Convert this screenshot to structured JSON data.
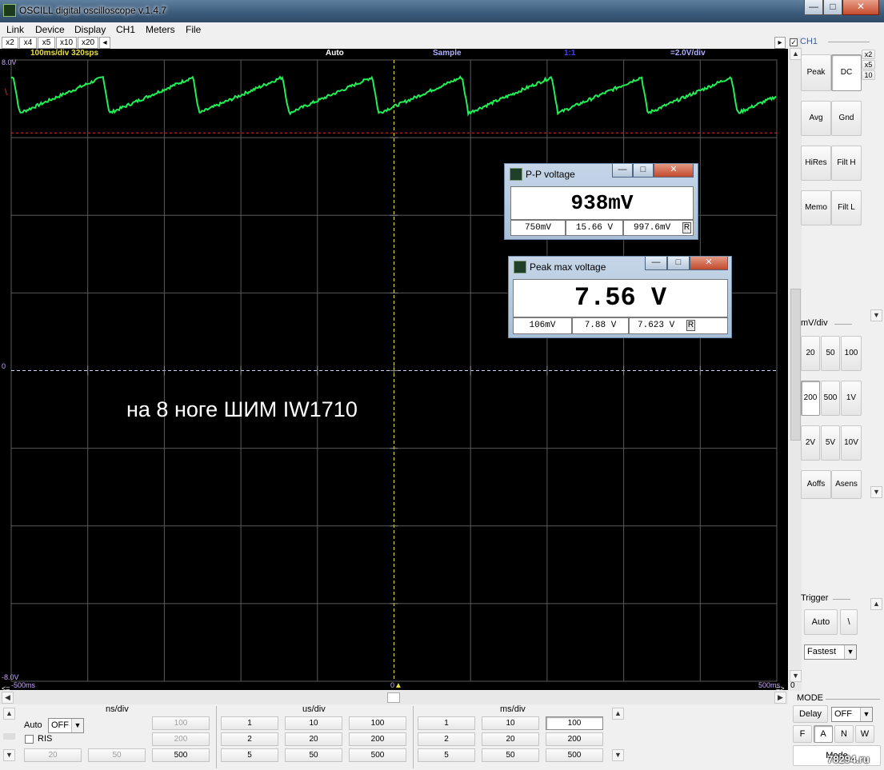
{
  "window": {
    "title": "OSCILL digital oscilloscope  v.1.4.7",
    "min_label": "—",
    "max_label": "□",
    "close_label": "✕"
  },
  "menu": [
    "Link",
    "Device",
    "Display",
    "CH1",
    "Meters",
    "File"
  ],
  "zoom_buttons": [
    "x2",
    "x4",
    "x5",
    "x10",
    "x20"
  ],
  "zoom_arrow": "◂",
  "scope_header": {
    "timebase": "100ms/div  320sps",
    "trigger": "Auto",
    "acq": "Sample",
    "ratio": "1:1",
    "vscale": "=2.0V/div"
  },
  "scope_labels": {
    "top_v": "8.0V",
    "zero_v": "0",
    "bottom_v": "-8.0V",
    "left_t": "-500ms",
    "center_t": "0",
    "right_t": "500ms",
    "left_arrow": "<=",
    "right_arrow": "=>",
    "ch_marker": "\\"
  },
  "annotation": "на 8 ноге ШИМ IW1710",
  "colors": {
    "trace": "#22ee55",
    "trigger_level": "#e03030",
    "cursor": "#e8e040",
    "grid": "#5a5a5a",
    "header_time": "#e8e040",
    "header_trig": "#ffffff",
    "header_acq": "#b0b0ff",
    "header_ratio": "#4040ff",
    "header_v": "#b0b0ff"
  },
  "meters": [
    {
      "title": "P-P voltage",
      "value": "938mV",
      "min": "750mV",
      "max": "15.66 V",
      "avg": "997.6mV",
      "reset": "R"
    },
    {
      "title": "Peak max voltage",
      "value": "7.56 V",
      "min": "106mV",
      "max": "7.88 V",
      "avg": "7.623 V",
      "reset": "R"
    }
  ],
  "right_panel": {
    "channel": "CH1",
    "zoom": [
      "x2",
      "x5",
      "10"
    ],
    "buttons": [
      "Peak",
      "DC",
      "Avg",
      "Gnd",
      "HiRes",
      "Filt H",
      "Memo",
      "Filt L"
    ],
    "mvdiv_label": "mV/div",
    "mvdiv": [
      "20",
      "50",
      "100",
      "200",
      "500",
      "1V",
      "2V",
      "5V",
      "10V"
    ],
    "aoffs": "Aoffs",
    "asens": "Asens",
    "trigger_label": "Trigger",
    "trigger_auto": "Auto",
    "trigger_edge": "\\",
    "trigger_speed": "Fastest"
  },
  "bottom": {
    "ns_label": "ns/div",
    "us_label": "us/div",
    "ms_label": "ms/div",
    "auto_label": "Auto",
    "auto_value": "OFF",
    "ris_label": "RIS",
    "ns_buttons": [
      "100",
      "200",
      "20",
      "50",
      "500"
    ],
    "us_buttons": [
      "1",
      "10",
      "100",
      "2",
      "20",
      "200",
      "5",
      "50",
      "500"
    ],
    "ms_buttons": [
      "1",
      "10",
      "100",
      "2",
      "20",
      "200",
      "5",
      "50",
      "500"
    ]
  },
  "mode_panel": {
    "label": "MODE",
    "delay": "Delay",
    "delay_value": "OFF",
    "modes": [
      "F",
      "A",
      "N",
      "W"
    ],
    "mode_text": "Mode"
  },
  "watermark": "78294.ru"
}
